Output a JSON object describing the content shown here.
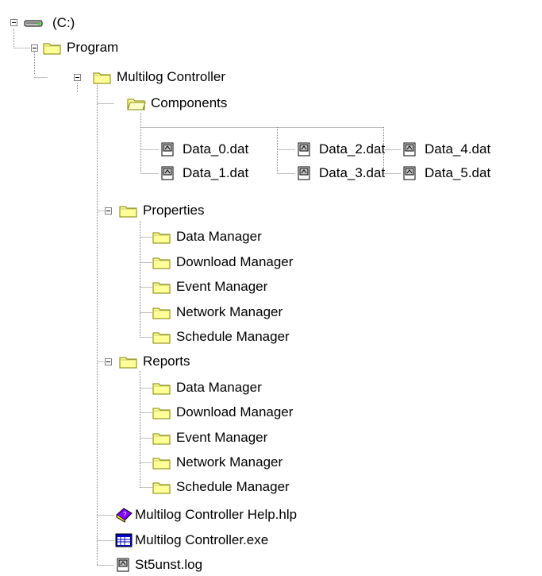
{
  "tree": {
    "drive": {
      "label": "(C:)",
      "icon": "hard-drive-icon"
    },
    "program": {
      "label": "Program",
      "icon": "folder-icon"
    },
    "multilog": {
      "label": "Multilog Controller",
      "icon": "folder-icon"
    },
    "components": {
      "label": "Components",
      "icon": "folder-open-icon"
    },
    "component_files": [
      "Data_0.dat",
      "Data_1.dat",
      "Data_2.dat",
      "Data_3.dat",
      "Data_4.dat",
      "Data_5.dat"
    ],
    "properties": {
      "label": "Properties",
      "icon": "folder-icon",
      "items": [
        "Data Manager",
        "Download Manager",
        "Event Manager",
        "Network Manager",
        "Schedule Manager"
      ]
    },
    "reports": {
      "label": "Reports",
      "icon": "folder-icon",
      "items": [
        "Data Manager",
        "Download Manager",
        "Event Manager",
        "Network Manager",
        "Schedule Manager"
      ]
    },
    "help_file": {
      "label": "Multilog Controller Help.hlp",
      "icon": "help-book-icon"
    },
    "exe_file": {
      "label": "Multilog Controller.exe",
      "icon": "application-icon"
    },
    "log_file": {
      "label": "St5unst.log",
      "icon": "log-file-icon"
    }
  }
}
